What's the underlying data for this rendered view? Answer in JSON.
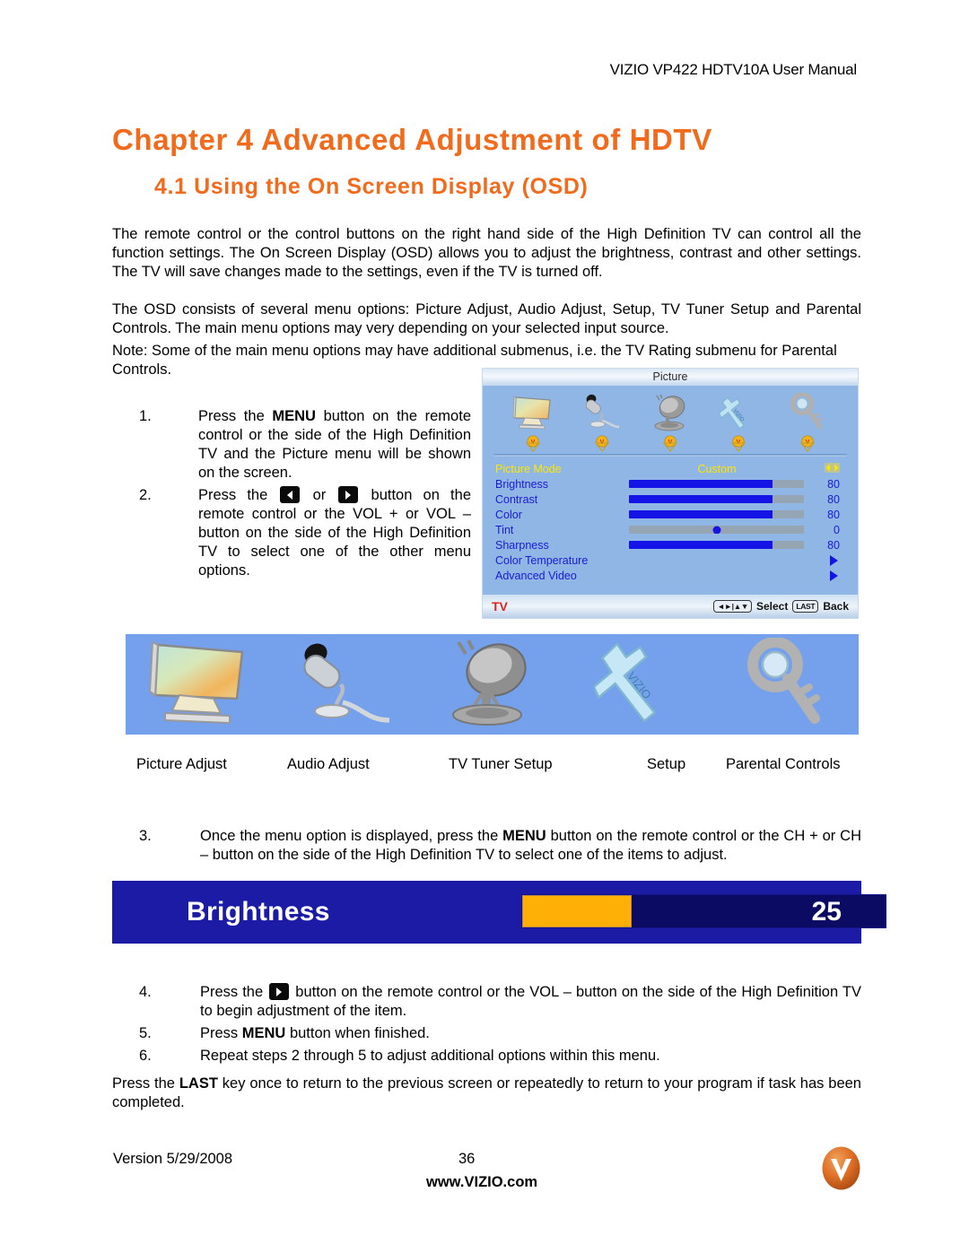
{
  "header": {
    "doc_title": "VIZIO VP422 HDTV10A User Manual"
  },
  "titles": {
    "chapter": "Chapter 4 Advanced Adjustment of HDTV",
    "section": "4.1 Using the On Screen Display (OSD)"
  },
  "paragraphs": {
    "intro": "The remote control or the control buttons on the right hand side of the High Definition TV can control all the function settings.  The On Screen Display (OSD) allows you to adjust the brightness, contrast and other settings.  The TV will save changes made to the settings, even if the TV is turned off.",
    "osd_menus": "The OSD consists of several menu options: Picture Adjust, Audio Adjust, Setup, TV Tuner Setup and Parental Controls.  The main menu options may very depending on your selected input source.",
    "note": "Note:  Some of the main menu options may have additional submenus, i.e. the TV Rating submenu for Parental Controls.",
    "closing_pre": "Press the ",
    "closing_bold": "LAST",
    "closing_post": " key once to return to the previous screen or repeatedly to return to your program if task has been completed."
  },
  "steps": {
    "one": {
      "num": "1.",
      "pre": "Press the ",
      "bold": "MENU",
      "post": " button on the remote control or the side of the High Definition TV and the Picture menu will be shown on the screen."
    },
    "two": {
      "num": "2.",
      "pre": "Press the ",
      "mid": " or ",
      "post": " button on the remote control or the VOL + or VOL – button on the side of the High Definition TV to select one of the other menu options."
    },
    "three": {
      "num": "3.",
      "pre": "Once the menu option is displayed, press the ",
      "bold": "MENU",
      "post": " button on the remote control or the CH + or CH – button on the side of the High Definition TV to select one of the items to adjust."
    },
    "four": {
      "num": "4.",
      "pre": "Press the ",
      "post": " button on the remote control or the VOL – button on the side of the High Definition TV to begin adjustment of the item."
    },
    "five": {
      "num": "5.",
      "pre": "Press ",
      "bold": "MENU",
      "post": " button when finished."
    },
    "six": {
      "num": "6.",
      "text": "Repeat steps 2 through 5 to adjust additional options within this menu."
    }
  },
  "osd": {
    "title": "Picture",
    "icons": [
      {
        "name": "monitor-icon",
        "label": "Picture Adjust"
      },
      {
        "name": "microphone-icon",
        "label": "Audio Adjust"
      },
      {
        "name": "satellite-dish-icon",
        "label": "TV Tuner Setup"
      },
      {
        "name": "wrench-icon",
        "label": "Setup"
      },
      {
        "name": "key-icon",
        "label": "Parental Controls"
      }
    ],
    "rows": [
      {
        "label": "Picture Mode",
        "type": "choice",
        "value": "Custom",
        "selected": true
      },
      {
        "label": "Brightness",
        "type": "slider",
        "value": "80",
        "percent": 82
      },
      {
        "label": "Contrast",
        "type": "slider",
        "value": "80",
        "percent": 82
      },
      {
        "label": "Color",
        "type": "slider",
        "value": "80",
        "percent": 82
      },
      {
        "label": "Tint",
        "type": "knob",
        "value": "0",
        "percent": 50
      },
      {
        "label": "Sharpness",
        "type": "slider",
        "value": "80",
        "percent": 82
      },
      {
        "label": "Color Temperature",
        "type": "submenu",
        "value": ""
      },
      {
        "label": "Advanced Video",
        "type": "submenu",
        "value": ""
      }
    ],
    "footer": {
      "source": "TV",
      "select_label": "Select",
      "last_key": "LAST",
      "back_label": "Back"
    }
  },
  "band": {
    "labels": [
      "Picture Adjust",
      "Audio Adjust",
      "TV Tuner Setup",
      "Setup",
      "Parental Controls"
    ]
  },
  "brightness_bar": {
    "label": "Brightness",
    "value": "25",
    "percent": 30
  },
  "footer": {
    "version": "Version 5/29/2008",
    "page_number": "36",
    "website": "www.VIZIO.com",
    "logo_letter": "V"
  },
  "colors": {
    "accent_orange": "#F26B1D",
    "band_blue": "#74A0EC",
    "osd_bg": "#8FB6E4",
    "osd_label_blue": "#1A1AD6",
    "osd_selected_yellow": "#FFE600",
    "slider_blue": "#1414E6",
    "brightness_bar_blue": "#1B1BA6",
    "brightness_fill_orange": "#FFAF05"
  }
}
